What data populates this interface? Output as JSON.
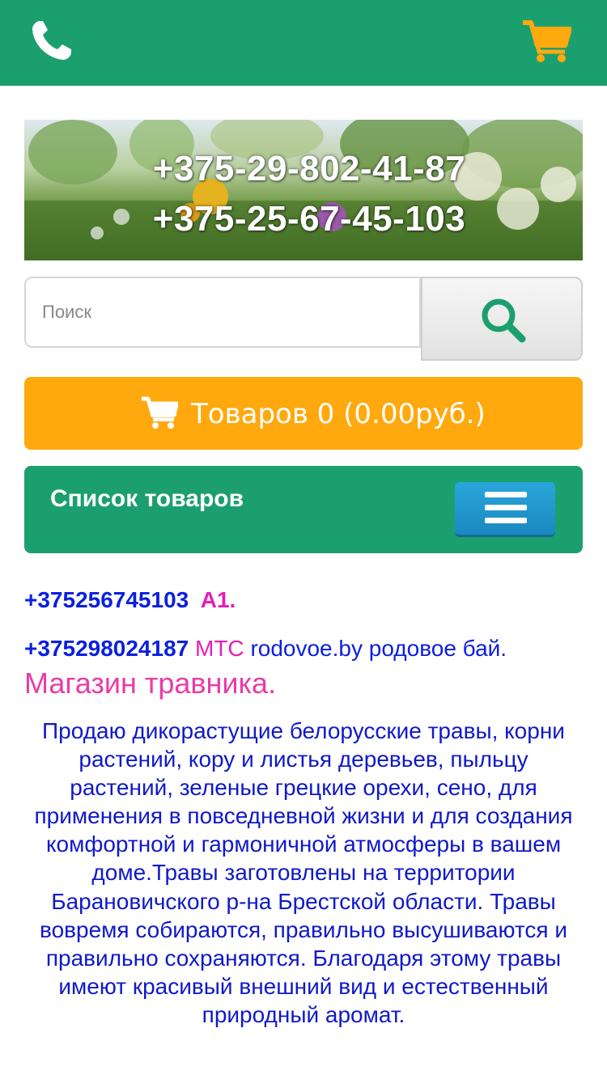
{
  "header": {
    "phone_icon": "phone-icon",
    "cart_icon": "shopping-cart-icon",
    "bar_color": "#1c9f6f",
    "cart_color": "#ffa90e"
  },
  "banner": {
    "phone1": "+375-29-802-41-87",
    "phone2": "+375-25-67-45-103"
  },
  "search": {
    "placeholder": "Поиск",
    "button_icon": "search-icon"
  },
  "cart": {
    "label": "Товаров 0 (0.00руб.)",
    "color": "#ffa90e"
  },
  "menu": {
    "title": "Список товаров",
    "button_icon": "hamburger-menu-icon"
  },
  "contacts": {
    "line1_phone": "+375256745103",
    "line1_op": "A1.",
    "line2_phone": "+375298024187",
    "line2_op": "MTC",
    "line2_site": "rodovoe.by родовое бай.",
    "shop_name": "Магазин травника."
  },
  "description": "Продаю дикорастущие белорусские травы, корни растений, кору и листья деревьев, пыльцу растений, зеленые грецкие орехи, сено, для применения в повседневной жизни и для создания комфортной и гармоничной атмосферы в вашем доме.Травы заготовлены на территории Барановичского р-на Брестской области. Травы вовремя собираются, правильно высушиваются и правильно сохраняются. Благодаря этому травы имеют красивый внешний вид и естественный природный аромат."
}
